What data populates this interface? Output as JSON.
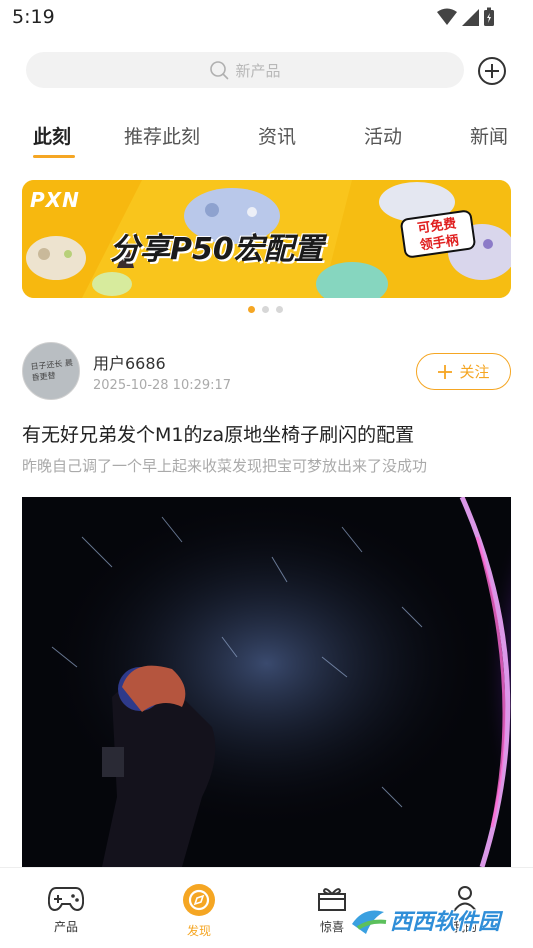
{
  "status_bar": {
    "time": "5:19"
  },
  "search": {
    "placeholder": "新产品"
  },
  "tabs": [
    {
      "label": "此刻",
      "active": true
    },
    {
      "label": "推荐此刻",
      "active": false
    },
    {
      "label": "资讯",
      "active": false
    },
    {
      "label": "活动",
      "active": false
    },
    {
      "label": "新闻",
      "active": false
    }
  ],
  "banner": {
    "logo_text": "PXN",
    "headline": "分享P50宏配置",
    "badge_line1": "可免费",
    "badge_line2": "领手柄",
    "pager_count": 3,
    "pager_active": 0
  },
  "post": {
    "avatar_text": "日子还长 晨昏更替",
    "username": "用户6686",
    "time": "2025-10-28 10:29:17",
    "follow_label": "关注",
    "title": "有无好兄弟发个M1的za原地坐椅子刷闪的配置",
    "summary": "昨晚自己调了一个早上起来收菜发现把宝可梦放出来了没成功"
  },
  "bottom_nav": [
    {
      "label": "产品",
      "icon": "gamepad-icon",
      "active": false
    },
    {
      "label": "发现",
      "icon": "compass-icon",
      "active": true
    },
    {
      "label": "惊喜",
      "icon": "gift-icon",
      "active": false
    },
    {
      "label": "我的",
      "icon": "profile-icon",
      "active": false
    }
  ],
  "watermark": {
    "text": "西西软件园"
  },
  "colors": {
    "accent": "#f5a623",
    "banner_bg": "#f9c51c"
  }
}
